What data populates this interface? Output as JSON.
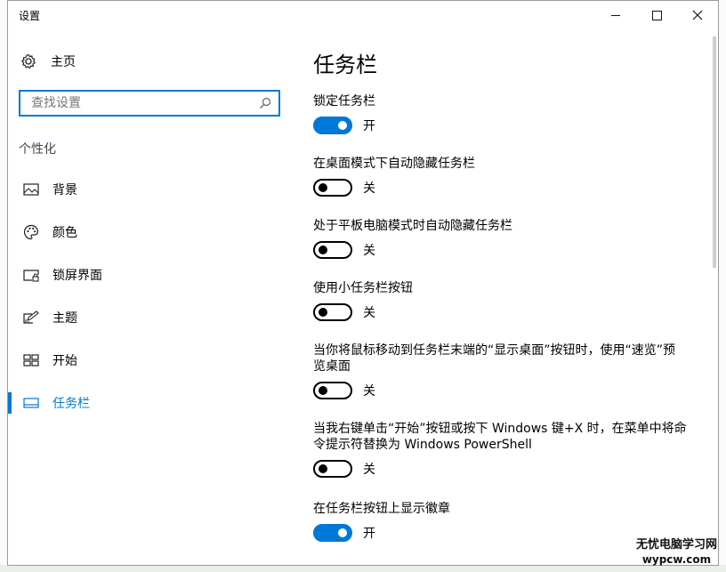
{
  "window": {
    "title": "设置"
  },
  "nav": {
    "home_label": "主页",
    "search_placeholder": "查找设置",
    "section_label": "个性化",
    "items": [
      {
        "label": "背景",
        "icon": "image-icon"
      },
      {
        "label": "颜色",
        "icon": "palette-icon"
      },
      {
        "label": "锁屏界面",
        "icon": "lock-screen-icon"
      },
      {
        "label": "主题",
        "icon": "theme-icon"
      },
      {
        "label": "开始",
        "icon": "start-icon"
      },
      {
        "label": "任务栏",
        "icon": "taskbar-icon",
        "active": true
      }
    ]
  },
  "main": {
    "title": "任务栏",
    "settings": [
      {
        "label": "锁定任务栏",
        "state": "开",
        "on": true
      },
      {
        "label": "在桌面模式下自动隐藏任务栏",
        "state": "关",
        "on": false
      },
      {
        "label": "处于平板电脑模式时自动隐藏任务栏",
        "state": "关",
        "on": false
      },
      {
        "label": "使用小任务栏按钮",
        "state": "关",
        "on": false
      },
      {
        "label": "当你将鼠标移动到任务栏末端的“显示桌面”按钮时，使用“速览”预览桌面",
        "state": "关",
        "on": false
      },
      {
        "label": "当我右键单击“开始”按钮或按下 Windows 键+X 时，在菜单中将命令提示符替换为 Windows PowerShell",
        "state": "关",
        "on": false
      },
      {
        "label": "在任务栏按钮上显示徽章",
        "state": "开",
        "on": true
      }
    ]
  },
  "watermark": {
    "line1": "无忧电脑学习网",
    "line2": "wypcw.com"
  },
  "colors": {
    "accent": "#0078d7"
  }
}
